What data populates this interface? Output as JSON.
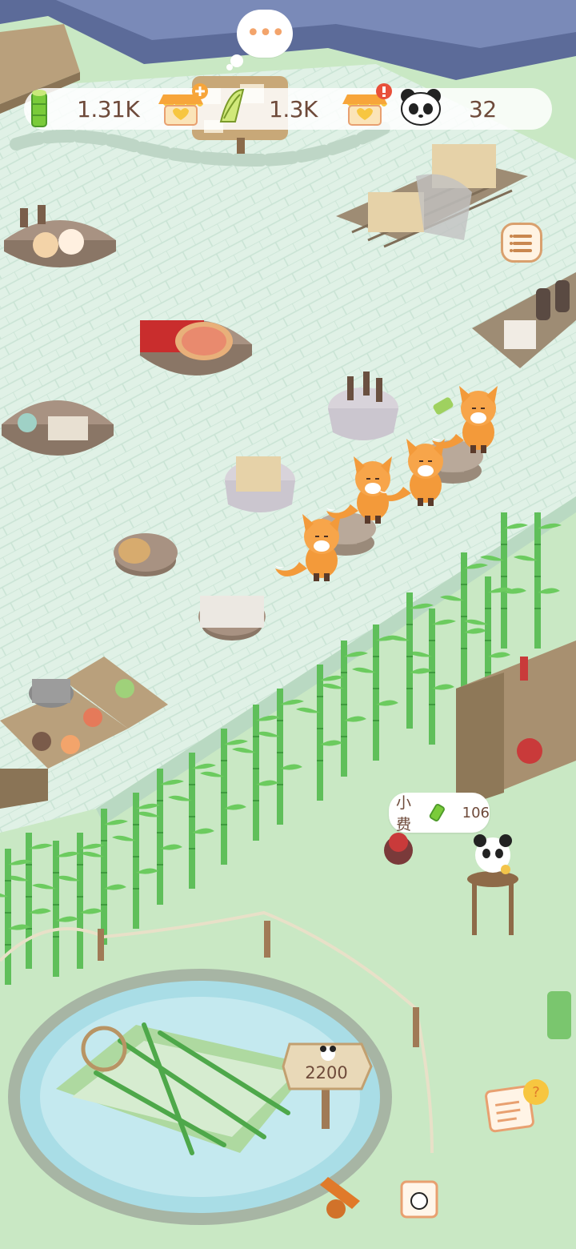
{
  "hud": {
    "bamboo_value": "1.31K",
    "coin_value": "1.3K",
    "panda_value": "32",
    "icons": [
      "bamboo-icon",
      "shop-add-icon",
      "bamboo-shoot-icon",
      "shop-alert-icon",
      "panda-icon"
    ]
  },
  "speech_bubble": {
    "text": "•••"
  },
  "tip": {
    "label": "小费",
    "value": "106"
  },
  "signpost": {
    "value": "2200"
  },
  "side_menu": {
    "icon": "list-menu-icon"
  },
  "bottom_icons": [
    "task-notebook-icon",
    "panda-card-icon",
    "fox-tool-icon"
  ],
  "colors": {
    "grass": "#c9e8c4",
    "floor": "#dff0e6",
    "accent": "#f3a46b",
    "text": "#6e4a3a"
  }
}
